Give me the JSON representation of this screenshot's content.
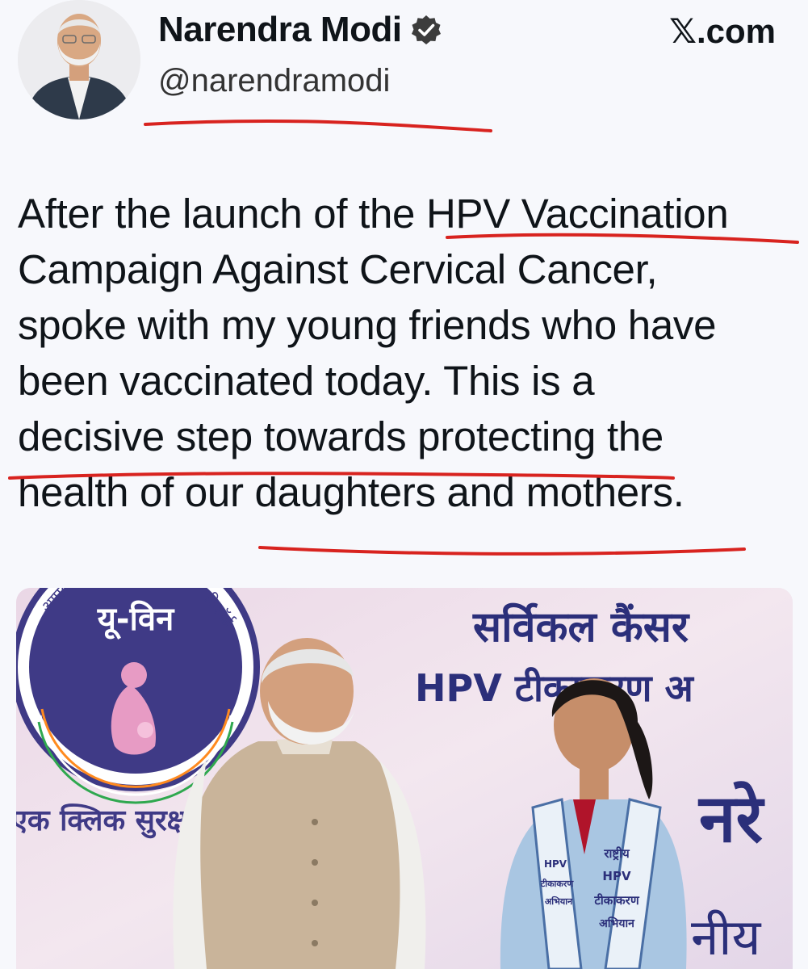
{
  "header": {
    "name": "Narendra Modi",
    "handle": "@narendramodi",
    "source": "𝕏.com",
    "verified_icon": "verified-badge-icon"
  },
  "tweet": {
    "lines": [
      "After the launch of the HPV Vaccination",
      "Campaign Against Cervical Cancer,",
      "spoke with my young friends who have",
      "been vaccinated today. This is a",
      "decisive step towards protecting the",
      "health of our daughters and mothers."
    ]
  },
  "photo": {
    "logo_text": "यू-विन",
    "logo_arc_left": "आपका",
    "logo_arc_right": "रिकॉर्ड",
    "logo_caption": "एक क्लिक सुरक्षा की",
    "banner_line1": "सर्विकल कैंसर",
    "banner_line2": "HPV टीकाकरण अ",
    "banner_partial_1": "नरे",
    "banner_partial_2": "नीय",
    "sash_text_1": "राष्ट्रीय",
    "sash_text_2": "HPV",
    "sash_text_3": "टीकाकरण",
    "sash_text_4": "अभियान",
    "sash_left_1": "HPV",
    "sash_left_2": "टीकाकरण",
    "sash_left_3": "अभियान"
  },
  "colors": {
    "accent_underline": "#d8231f",
    "verified": "#1d9bf0",
    "banner_text": "#2b2f7a",
    "logo_circle": "#3f3a86"
  }
}
